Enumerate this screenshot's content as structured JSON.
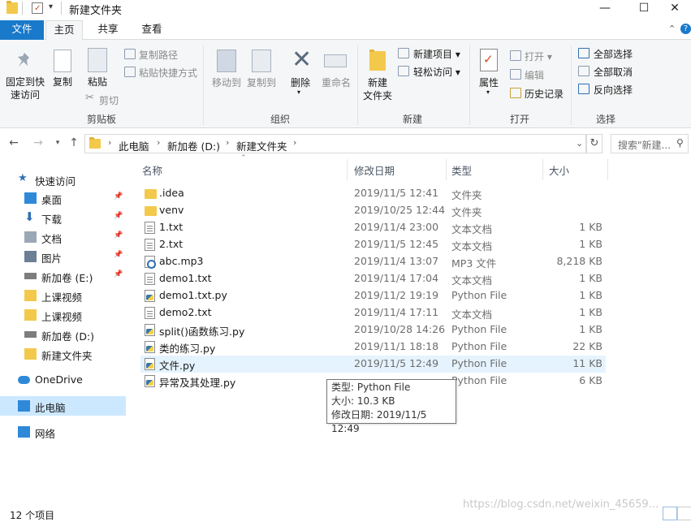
{
  "window": {
    "title": "新建文件夹",
    "minimize": "—",
    "maximize": "☐",
    "close": "✕"
  },
  "tabs": [
    "文件",
    "主页",
    "共享",
    "查看"
  ],
  "ribbon": {
    "pin_quick_access": [
      "固定到快",
      "速访问"
    ],
    "copy": "复制",
    "paste": "粘贴",
    "copy_path": "复制路径",
    "paste_shortcut": "粘贴快捷方式",
    "cut": "剪切",
    "clipboard_group": "剪贴板",
    "move_to": "移动到",
    "copy_to": "复制到",
    "delete": "删除",
    "rename": "重命名",
    "organize_group": "组织",
    "new_folder": [
      "新建",
      "文件夹"
    ],
    "new_item": "新建项目",
    "easy_access": "轻松访问",
    "new_group": "新建",
    "properties": "属性",
    "open": "打开",
    "edit": "编辑",
    "history": "历史记录",
    "open_group": "打开",
    "select_all": "全部选择",
    "select_none": "全部取消",
    "invert_selection": "反向选择",
    "select_group": "选择"
  },
  "address": {
    "crumbs": [
      "此电脑",
      "新加卷 (D:)",
      "新建文件夹"
    ],
    "search_placeholder": "搜索\"新建..."
  },
  "sidebar": {
    "items": [
      {
        "label": "快速访问",
        "icon": "star-icon",
        "pinned": false
      },
      {
        "label": "桌面",
        "icon": "desktop-icon",
        "pinned": true
      },
      {
        "label": "下载",
        "icon": "download-icon",
        "pinned": true
      },
      {
        "label": "文档",
        "icon": "document-icon",
        "pinned": true
      },
      {
        "label": "图片",
        "icon": "picture-icon",
        "pinned": true
      },
      {
        "label": "新加卷 (E:)",
        "icon": "drive-icon",
        "pinned": true
      },
      {
        "label": "上课视频",
        "icon": "folder-icon",
        "pinned": false
      },
      {
        "label": "上课视频",
        "icon": "folder-icon",
        "pinned": false
      },
      {
        "label": "新加卷 (D:)",
        "icon": "drive-icon",
        "pinned": false
      },
      {
        "label": "新建文件夹",
        "icon": "folder-icon",
        "pinned": false
      },
      {
        "label": "OneDrive",
        "icon": "cloud-icon",
        "pinned": false
      },
      {
        "label": "此电脑",
        "icon": "computer-icon",
        "pinned": false
      },
      {
        "label": "网络",
        "icon": "network-icon",
        "pinned": false
      }
    ]
  },
  "columns": {
    "name": "名称",
    "modified": "修改日期",
    "type": "类型",
    "size": "大小"
  },
  "files": [
    {
      "name": ".idea",
      "modified": "2019/11/5 12:41",
      "type": "文件夹",
      "size": "",
      "icon": "folder"
    },
    {
      "name": "venv",
      "modified": "2019/10/25 12:44",
      "type": "文件夹",
      "size": "",
      "icon": "folder"
    },
    {
      "name": "1.txt",
      "modified": "2019/11/4 23:00",
      "type": "文本文档",
      "size": "1 KB",
      "icon": "doc"
    },
    {
      "name": "2.txt",
      "modified": "2019/11/5 12:45",
      "type": "文本文档",
      "size": "1 KB",
      "icon": "doc"
    },
    {
      "name": "abc.mp3",
      "modified": "2019/11/4 13:07",
      "type": "MP3 文件",
      "size": "8,218 KB",
      "icon": "mp3"
    },
    {
      "name": "demo1.txt",
      "modified": "2019/11/4 17:04",
      "type": "文本文档",
      "size": "1 KB",
      "icon": "doc"
    },
    {
      "name": "demo1.txt.py",
      "modified": "2019/11/2 19:19",
      "type": "Python File",
      "size": "1 KB",
      "icon": "py"
    },
    {
      "name": "demo2.txt",
      "modified": "2019/11/4 17:11",
      "type": "文本文档",
      "size": "1 KB",
      "icon": "doc"
    },
    {
      "name": "split()函数练习.py",
      "modified": "2019/10/28 14:26",
      "type": "Python File",
      "size": "1 KB",
      "icon": "py"
    },
    {
      "name": "类的练习.py",
      "modified": "2019/11/1 18:18",
      "type": "Python File",
      "size": "22 KB",
      "icon": "py"
    },
    {
      "name": "文件.py",
      "modified": "2019/11/5 12:49",
      "type": "Python File",
      "size": "11 KB",
      "icon": "py",
      "selected": true
    },
    {
      "name": "异常及其处理.py",
      "modified": "",
      "type": "Python File",
      "size": "6 KB",
      "icon": "py"
    }
  ],
  "tooltip": {
    "type": "类型: Python File",
    "size": "大小: 10.3 KB",
    "modified": "修改日期: 2019/11/5 12:49"
  },
  "status": {
    "count": "12 个项目"
  },
  "watermark": "https://blog.csdn.net/weixin_45659..."
}
